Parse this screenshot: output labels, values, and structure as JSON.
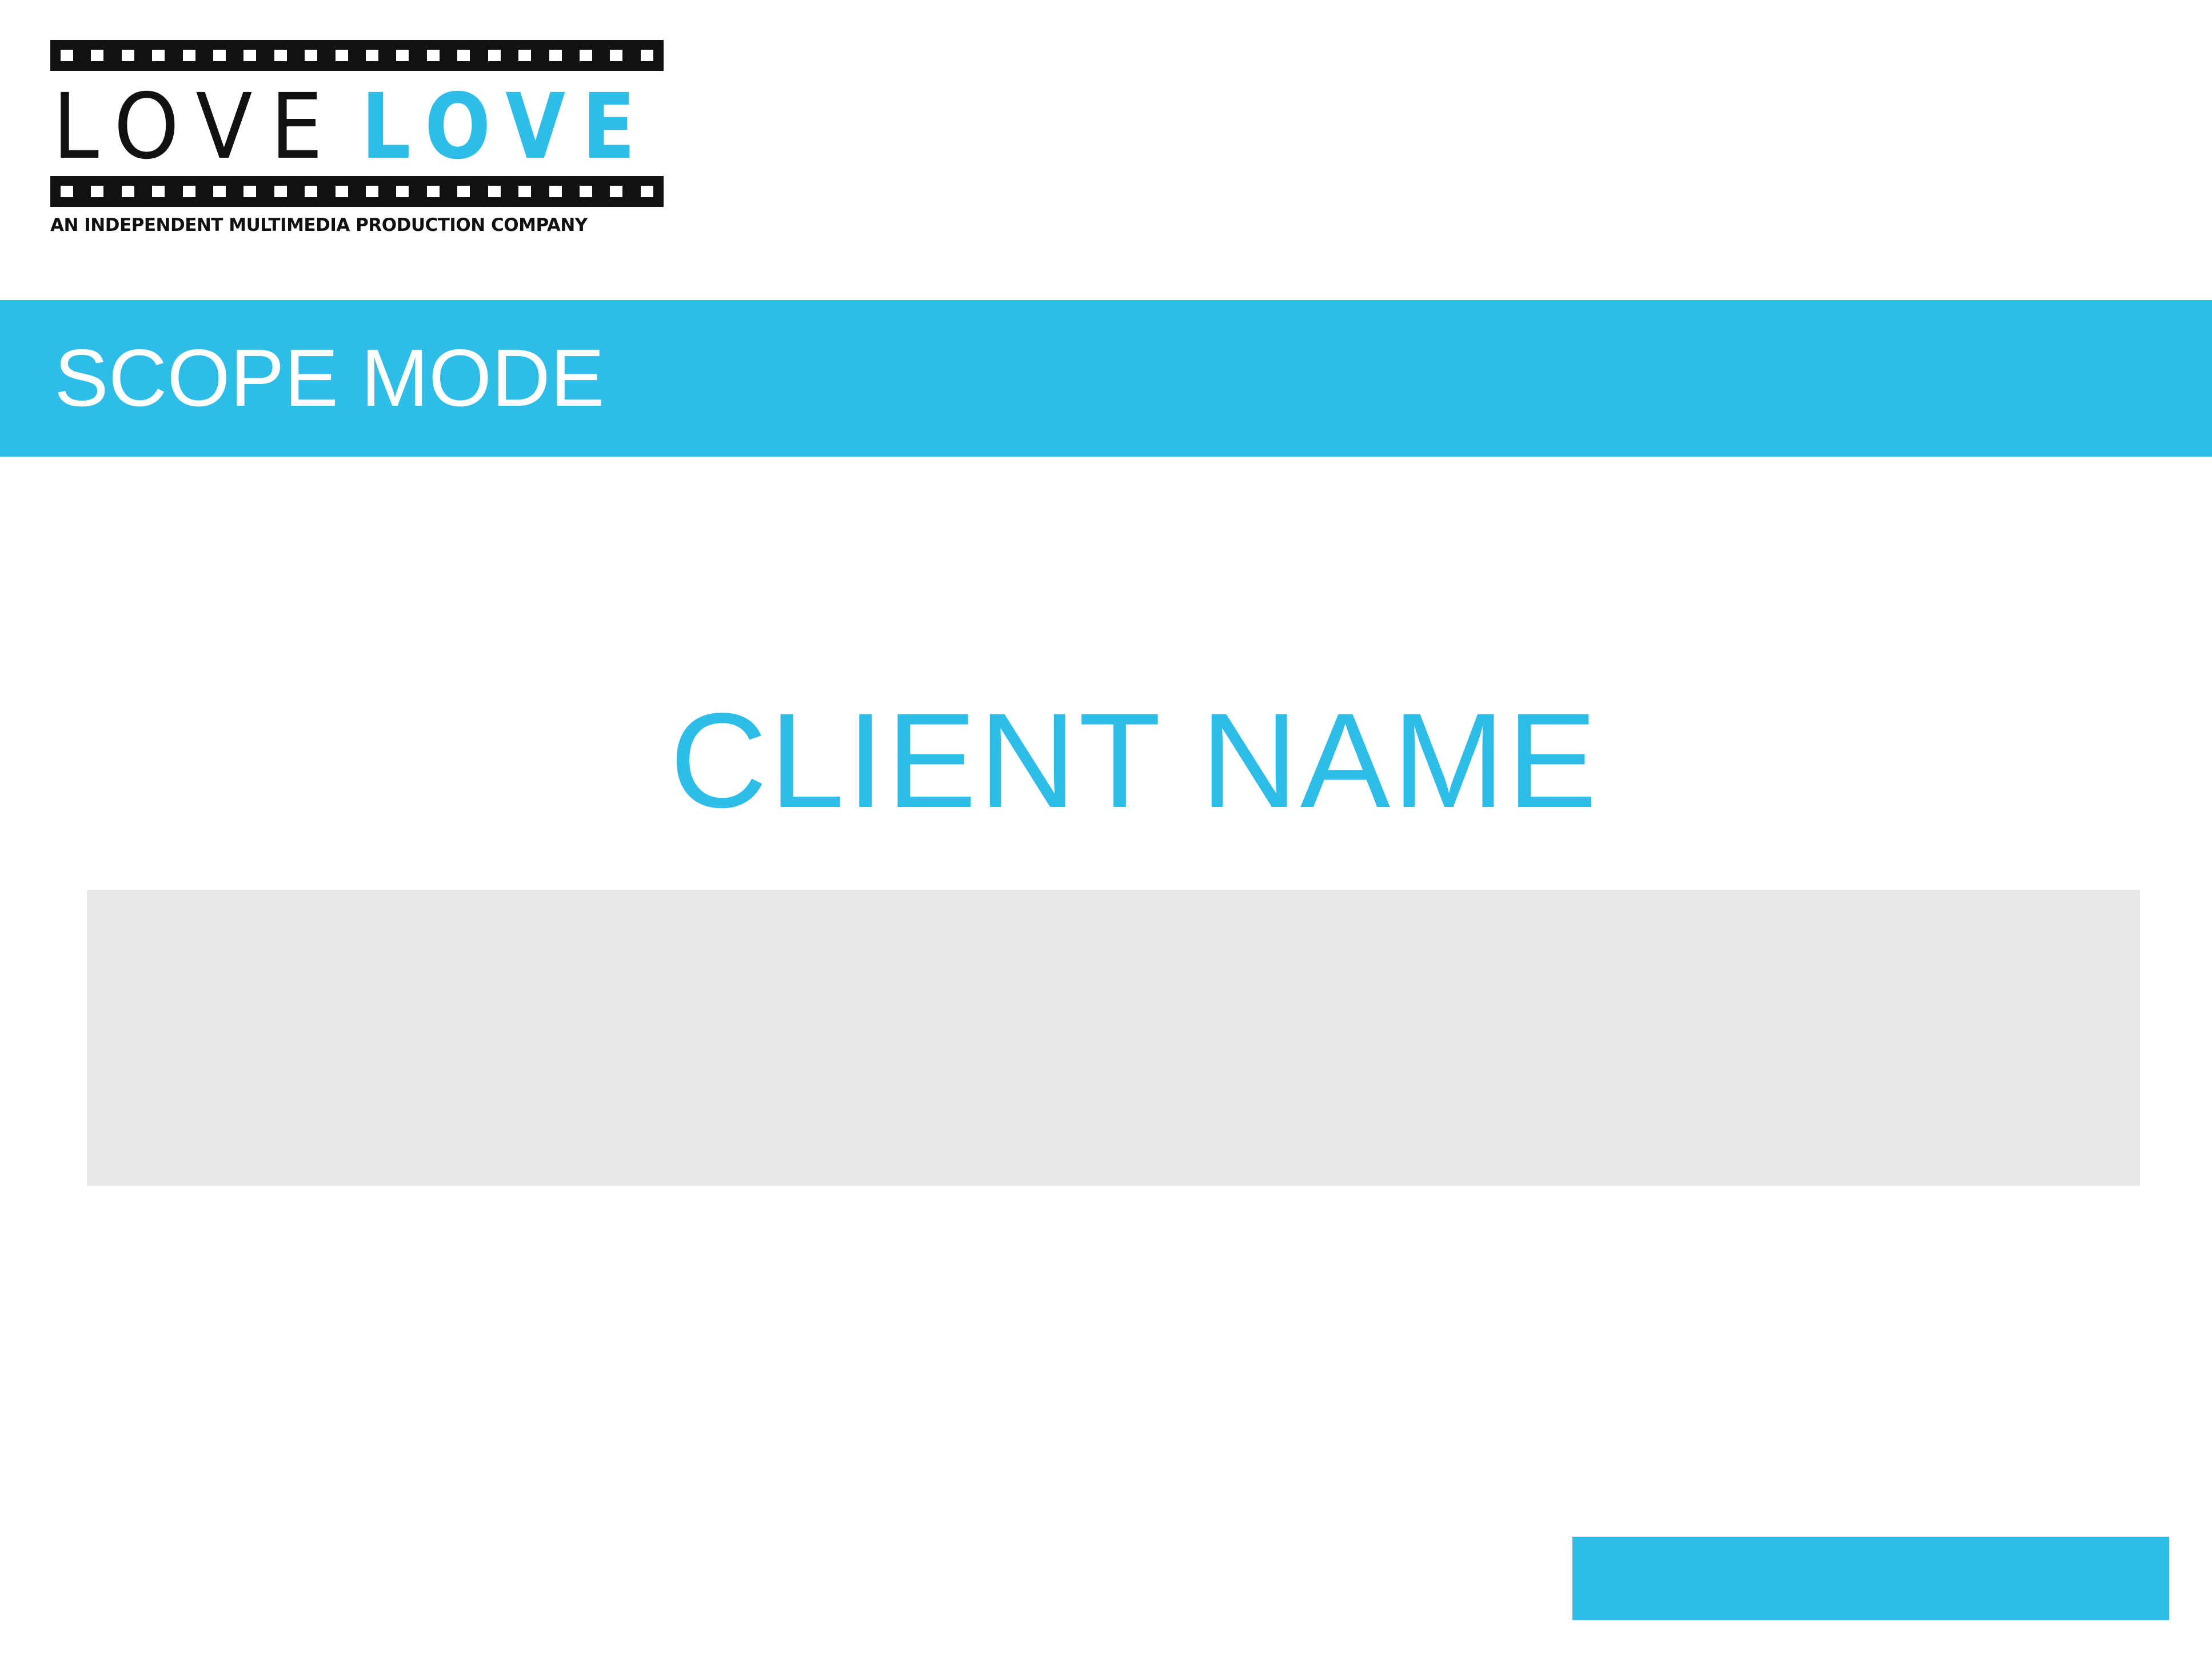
{
  "brand": {
    "wordmark_dark": "LOVE",
    "wordmark_blue": "LOVE",
    "tagline": "AN INDEPENDENT MULTIMEDIA PRODUCTION COMPANY"
  },
  "header": {
    "mode_title": "SCOPE MODE"
  },
  "main": {
    "client_name": "CLIENT NAME"
  },
  "colors": {
    "accent": "#2ebce8",
    "panel": "#e6e7e9",
    "text_dark": "#111111",
    "background": "#ffffff"
  }
}
